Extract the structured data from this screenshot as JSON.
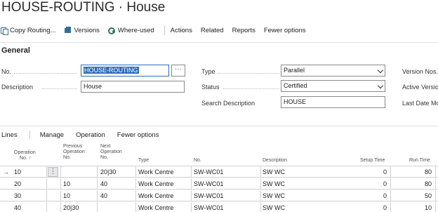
{
  "page": {
    "title": "HOUSE-ROUTING · House"
  },
  "actions": {
    "copy_routing": "Copy Routing...",
    "versions": "Versions",
    "where_used": "Where-used",
    "actions": "Actions",
    "related": "Related",
    "reports": "Reports",
    "fewer_options": "Fewer options"
  },
  "general": {
    "title": "General",
    "no_label": "No.",
    "no_value": "HOUSE-ROUTING",
    "description_label": "Description",
    "description_value": "House",
    "type_label": "Type",
    "type_value": "Parallel",
    "status_label": "Status",
    "status_value": "Certified",
    "search_description_label": "Search Description",
    "search_description_value": "HOUSE",
    "version_nos_label": "Version Nos.",
    "active_version_label": "Active Version",
    "last_date_modified_label": "Last Date Mod"
  },
  "lines": {
    "title": "Lines",
    "manage": "Manage",
    "operation": "Operation",
    "fewer_options": "Fewer options",
    "columns": {
      "op_no_1": "Operation",
      "op_no_2": "No. ↑",
      "prev_1": "Previous",
      "prev_2": "Operation",
      "prev_3": "No.",
      "next_1": "Next",
      "next_2": "Operation",
      "next_3": "No.",
      "type": "Type",
      "no": "No.",
      "description": "Description",
      "setup_time": "Setup Time",
      "run_time": "Run Time"
    },
    "rows": [
      {
        "op": "10",
        "prev": "",
        "next": "20|30",
        "type": "Work Centre",
        "no": "SW-WC01",
        "desc": "SW WC",
        "setup": "0",
        "run": "80"
      },
      {
        "op": "20",
        "prev": "10",
        "next": "40",
        "type": "Work Centre",
        "no": "SW-WC01",
        "desc": "SW WC",
        "setup": "0",
        "run": "80"
      },
      {
        "op": "30",
        "prev": "10",
        "next": "40",
        "type": "Work Centre",
        "no": "SW-WC01",
        "desc": "SW WC",
        "setup": "0",
        "run": "50"
      },
      {
        "op": "40",
        "prev": "20|30",
        "next": "",
        "type": "Work Centre",
        "no": "SW-WC01",
        "desc": "SW WC",
        "setup": "0",
        "run": "10"
      }
    ],
    "row_arrow_icon": "arrow-right-icon",
    "row_menu_icon": "vertical-ellipsis-icon"
  },
  "colors": {
    "accent": "#2a6ebb",
    "border": "#8a8a8a",
    "green": "#2d7d46"
  }
}
